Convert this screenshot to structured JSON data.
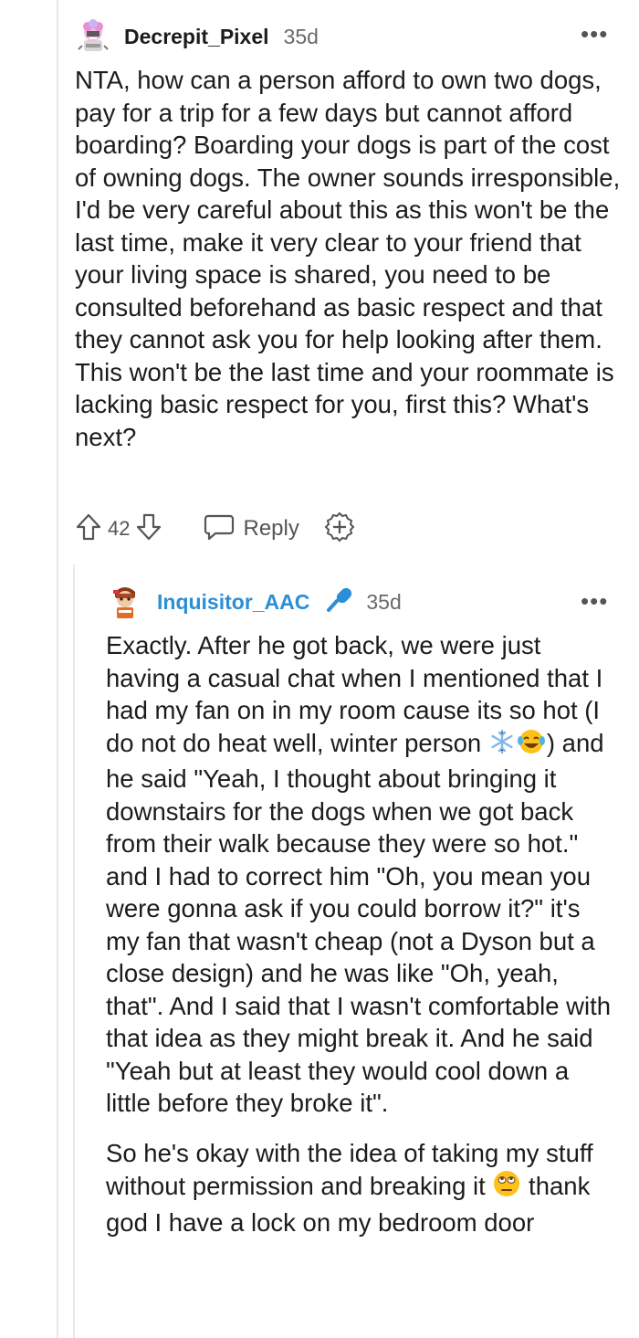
{
  "comments": [
    {
      "username": "Decrepit_Pixel",
      "age": "35d",
      "more_icon": "more-horizontal-icon",
      "body": "NTA, how can a person afford to own two dogs, pay for a trip for a few days but cannot afford boarding? Boarding your dogs is part of the cost of owning dogs. The owner sounds irresponsible, I'd be very careful about this as this won't be the last time, make it very clear to your friend that your living space is shared, you need to be consulted beforehand as basic respect and that they cannot ask you for help looking after them. This won't be the last time and your roommate is lacking basic respect for you, first this? What's next?",
      "votes": "42",
      "reply_label": "Reply",
      "icons": [
        "upvote-icon",
        "downvote-icon",
        "reply-bubble-icon",
        "award-icon"
      ]
    },
    {
      "username": "Inquisitor_AAC",
      "age": "35d",
      "flair_icon": "microphone-icon",
      "more_icon": "more-horizontal-icon",
      "body_p1_a": "Exactly. After he got back, we were just having a casual chat when I mentioned that I had my fan on in my room cause its so hot (I do not do heat well, winter person ",
      "body_p1_b": ") and he said \"Yeah, I thought about bringing it downstairs for the dogs when we got back from their walk because they were so hot.\" and I had to correct him \"Oh, you mean you were gonna ask if you could borrow it?\" it's my fan that wasn't cheap (not a Dyson but a close design) and he was like \"Oh, yeah, that\". And I said that I wasn't comfortable with that idea as they might break it. And he said \"Yeah but at least they would cool down a little before they broke it\".",
      "body_p2_a": "So he's okay with the idea of taking my stuff without permission and breaking it ",
      "body_p2_b": " thank god I have a lock on my bedroom door",
      "emoji_icons": [
        "snowflake-emoji",
        "laughing-tears-emoji",
        "eye-roll-emoji"
      ]
    }
  ],
  "colors": {
    "op_username": "#2c8ed6",
    "meta_gray": "#6a6a6a",
    "thread_line": "#e8e8e8"
  }
}
